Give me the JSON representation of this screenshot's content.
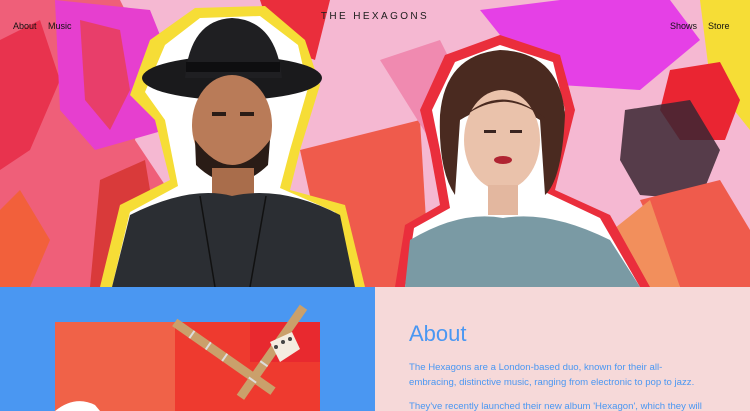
{
  "nav": {
    "brand": "THE HEXAGONS",
    "left_links": [
      "About",
      "Music"
    ],
    "right_links": [
      "Shows",
      "Store"
    ]
  },
  "hero": {
    "image_description": "two band members photographed against a colorful collage background",
    "colors": {
      "pink": "#f5b8d2",
      "magenta": "#e83fe4",
      "red": "#ea2e3c",
      "yellow": "#f6dd36",
      "coral": "#ef5b4c"
    }
  },
  "about": {
    "title": "About",
    "paragraph1": "The Hexagons are a London-based duo, known for their all-embracing, distinctive music, ranging from electronic to pop to jazz.",
    "paragraph2": "They've recently launched their new album 'Hexagon', which they will be"
  },
  "colors": {
    "accent_blue": "#4a97f2",
    "panel_pink": "#f6d9d9"
  }
}
